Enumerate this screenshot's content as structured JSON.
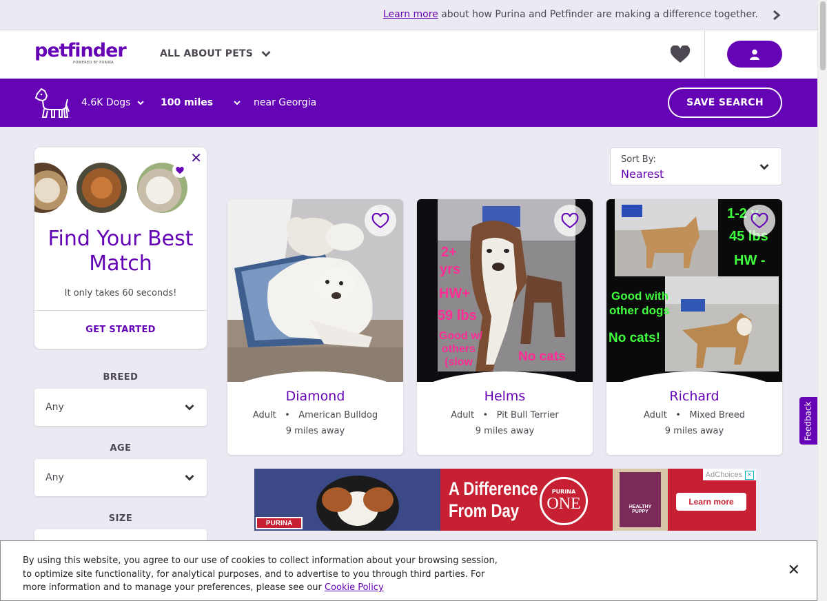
{
  "promo": {
    "link_text": "Learn more",
    "text": " about how Purina and Petfinder are making a difference together."
  },
  "header": {
    "logo": "petfinder",
    "logo_sub": "POWERED BY PURINA",
    "nav_about": "ALL ABOUT PETS"
  },
  "searchbar": {
    "count": "4.6K Dogs",
    "distance": "100 miles",
    "location": "near Georgia",
    "save_search": "SAVE SEARCH"
  },
  "match": {
    "title": "Find Your Best Match",
    "subtitle": "It only takes 60 seconds!",
    "cta": "GET STARTED"
  },
  "filters": [
    {
      "label": "BREED",
      "value": "Any"
    },
    {
      "label": "AGE",
      "value": "Any"
    },
    {
      "label": "SIZE",
      "value": ""
    }
  ],
  "sort": {
    "label": "Sort By:",
    "value": "Nearest"
  },
  "pets": [
    {
      "name": "Diamond",
      "age": "Adult",
      "breed": "American Bulldog",
      "distance": "9 miles away"
    },
    {
      "name": "Helms",
      "age": "Adult",
      "breed": "Pit Bull Terrier",
      "distance": "9 miles away"
    },
    {
      "name": "Richard",
      "age": "Adult",
      "breed": "Mixed Breed",
      "distance": "9 miles away"
    }
  ],
  "photo_text": {
    "helms": [
      "2+",
      "yrs",
      "HW+",
      "59 lbs",
      "Good w/",
      "others",
      "(slow",
      "No cats"
    ],
    "richard": [
      "1-2 y",
      "45 lbs",
      "HW -",
      "Good with",
      "other dogs",
      "No cats!"
    ]
  },
  "ad": {
    "headline_1": "A Difference",
    "headline_2": "From Day",
    "logo_brand": "PURINA",
    "logo_one": "ONE",
    "cta": "Learn more",
    "adchoices": "AdChoices",
    "brand": "PURINA",
    "product": "HEALTHY PUPPY"
  },
  "feedback": "Feedback",
  "cookie": {
    "text": "By using this website, you agree to our use of cookies to collect information about your browsing session, to optimize site functionality, for analytical purposes, and to advertise to you through third parties. For more information and to manage your preferences, please see our ",
    "link": "Cookie Policy"
  },
  "colors": {
    "brand_purple": "#6504b5",
    "background": "#ebe9f1",
    "ad_red": "#c62032"
  }
}
